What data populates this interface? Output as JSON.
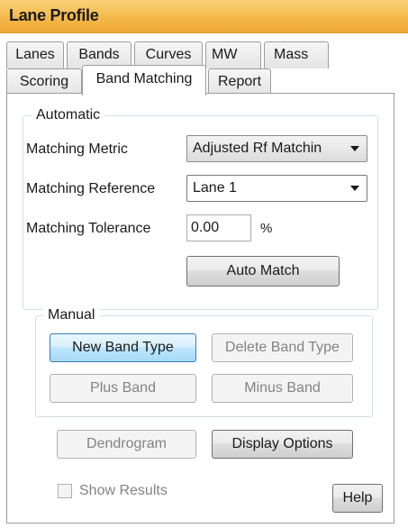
{
  "window": {
    "title": "Lane Profile"
  },
  "tabs": {
    "row1": [
      {
        "label": "Lanes"
      },
      {
        "label": "Bands"
      },
      {
        "label": "Curves"
      },
      {
        "label": "MW"
      },
      {
        "label": "Mass"
      }
    ],
    "row2": [
      {
        "label": "Scoring",
        "active": false
      },
      {
        "label": "Band Matching",
        "active": true
      },
      {
        "label": "Report",
        "active": false
      }
    ]
  },
  "automatic": {
    "group_label": "Automatic",
    "metric_label": "Matching Metric",
    "metric_value": "Adjusted Rf Matchin",
    "reference_label": "Matching Reference",
    "reference_value": "Lane 1",
    "tolerance_label": "Matching Tolerance",
    "tolerance_value": "0.00",
    "tolerance_unit": "%",
    "auto_match_label": "Auto Match"
  },
  "manual": {
    "group_label": "Manual",
    "new_band_type_label": "New Band Type",
    "delete_band_type_label": "Delete Band Type",
    "plus_band_label": "Plus Band",
    "minus_band_label": "Minus Band"
  },
  "footer": {
    "dendrogram_label": "Dendrogram",
    "display_options_label": "Display Options",
    "show_results_label": "Show Results",
    "show_results_checked": false,
    "help_label": "Help"
  },
  "colors": {
    "title_bar": "#f4b84a",
    "group_border": "#d5dfe5",
    "focused_button": "#a7d9f5",
    "disabled_text": "#838383"
  }
}
